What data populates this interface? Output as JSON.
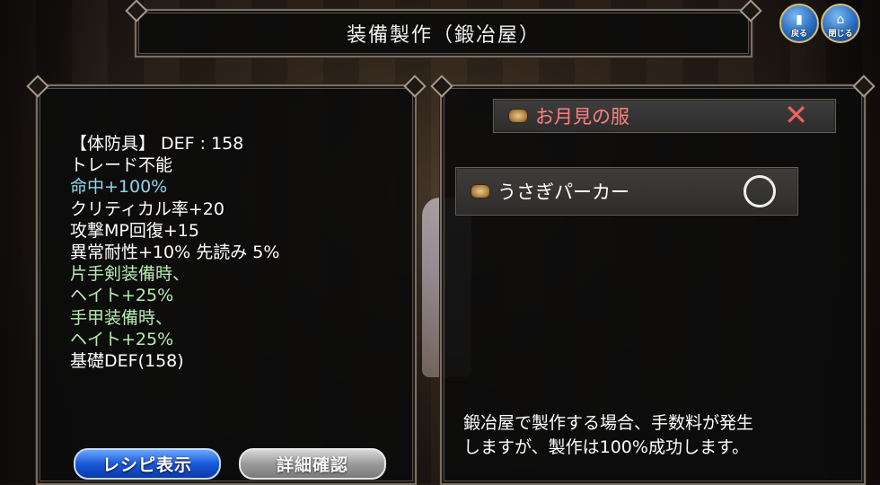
{
  "window": {
    "title": "装備製作（鍛冶屋）"
  },
  "corner_buttons": {
    "back_label": "戻る",
    "close_label": "閉じる"
  },
  "stats": {
    "lines": [
      {
        "text": "【体防具】 DEF : 158",
        "color": "white"
      },
      {
        "text": "トレード不能",
        "color": "white"
      },
      {
        "text": "命中+100%",
        "color": "cyan"
      },
      {
        "text": "クリティカル率+20",
        "color": "white"
      },
      {
        "text": "攻撃MP回復+15",
        "color": "white"
      },
      {
        "text": "異常耐性+10% 先読み 5%",
        "color": "white"
      },
      {
        "text": "片手剣装備時、",
        "color": "green"
      },
      {
        "text": "ヘイト+25%",
        "color": "green"
      },
      {
        "text": "手甲装備時、",
        "color": "green"
      },
      {
        "text": "ヘイト+25%",
        "color": "green"
      },
      {
        "text": "基礎DEF(158)",
        "color": "white"
      }
    ]
  },
  "recipes": [
    {
      "name": "お月見の服",
      "mark": "✕",
      "available": false
    },
    {
      "name": "うさぎパーカー",
      "mark": "○",
      "available": true
    }
  ],
  "note": {
    "line1": "鍛冶屋で製作する場合、手数料が発生",
    "line2": "しますが、製作は100%成功します。"
  },
  "buttons": {
    "recipe_label": "レシピ表示",
    "detail_label": "詳細確認"
  },
  "colors": {
    "cyan": "#8fd6ee",
    "green": "#b6ecb0",
    "red": "#ff7f7f"
  }
}
